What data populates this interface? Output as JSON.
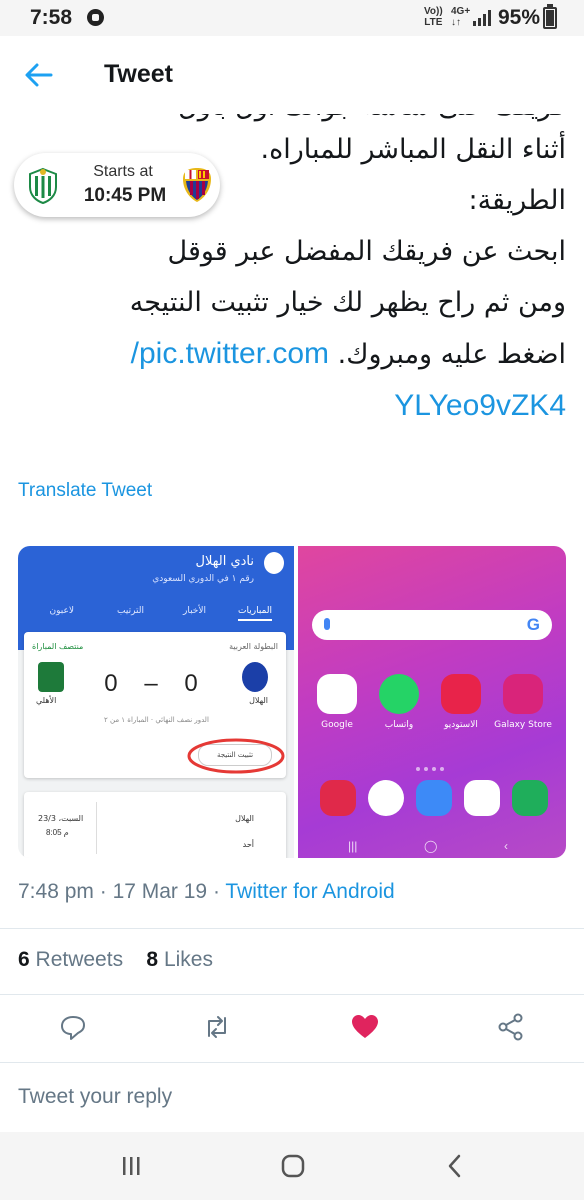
{
  "status_bar": {
    "time": "7:58",
    "volte_line1": "Vo))",
    "volte_line2": "LTE",
    "network_line1": "4G+",
    "network_line2": "↓↑",
    "battery_text": "95%"
  },
  "header": {
    "title": "Tweet",
    "back_icon": "back-arrow-icon"
  },
  "match_chip": {
    "label": "Starts at",
    "kickoff": "10:45 PM",
    "home_crest": "real-betis-crest-icon",
    "away_crest": "fc-barcelona-crest-icon"
  },
  "tweet": {
    "line_partial": "فريقك على شاشة جوالك أول بأول",
    "line_1": "أثناء النقل المباشر للمباراه.",
    "line_2": "الطريقة:",
    "line_3": " ابحث عن فريقك المفضل عبر قوقل",
    "line_4": "ومن ثم راح يظهر لك خيار تثبيت النتيجه",
    "line_5_text": "اضغط عليه ومبروك.",
    "link_part1": "pic.twitter.com/",
    "link_part2": "YLYeo9vZK4",
    "translate_label": "Translate Tweet"
  },
  "media": {
    "left": {
      "club_name": "نادي الهلال",
      "club_rank": "رقم ١ في الدوري السعودي",
      "tabs": [
        "المباريات",
        "الأخبار",
        "الترتيب",
        "لاعبون"
      ],
      "league": "البطولة العربية",
      "match_state": "منتصف المباراة",
      "score": "0 – 0",
      "team_home": "الأهلي",
      "team_away": "الهلال",
      "round": "الدور نصف النهائي · المباراة ١ من ٢",
      "pin_label": "تثبيت النتيجة",
      "next_team_1": "الهلال",
      "next_team_2": "أحد",
      "next_date": "السبت، 23/3",
      "next_time": "8:05 م"
    },
    "right": {
      "search_letter": "G",
      "apps": [
        {
          "label": "Google",
          "color": "#ffffff"
        },
        {
          "label": "واتساب",
          "color": "#25d366"
        },
        {
          "label": "الاستوديو",
          "color": "#e8234a"
        },
        {
          "label": "Galaxy Store",
          "color": "#d9247a"
        }
      ],
      "dock": [
        {
          "name": "camera-icon",
          "color": "#e0294a"
        },
        {
          "name": "chrome-icon",
          "color": "#ffffff"
        },
        {
          "name": "messages-icon",
          "color": "#3d8af7"
        },
        {
          "name": "play-store-icon",
          "color": "#ffffff"
        },
        {
          "name": "phone-icon",
          "color": "#1fae5b"
        }
      ],
      "nav": [
        "|||",
        "◯",
        "‹"
      ]
    }
  },
  "meta": {
    "time": "7:48 pm",
    "separator": " · ",
    "date": "17 Mar 19",
    "via": "Twitter for Android"
  },
  "stats": {
    "retweets_count": "6",
    "retweets_label": "Retweets",
    "likes_count": "8",
    "likes_label": "Likes"
  },
  "actions": {
    "reply": "reply-icon",
    "retweet": "retweet-icon",
    "like": "heart-icon",
    "like_color": "#e0245e",
    "share": "share-icon"
  },
  "reply_prompt": "Tweet your reply",
  "colors": {
    "link": "#1b95e0",
    "muted": "#657786"
  }
}
